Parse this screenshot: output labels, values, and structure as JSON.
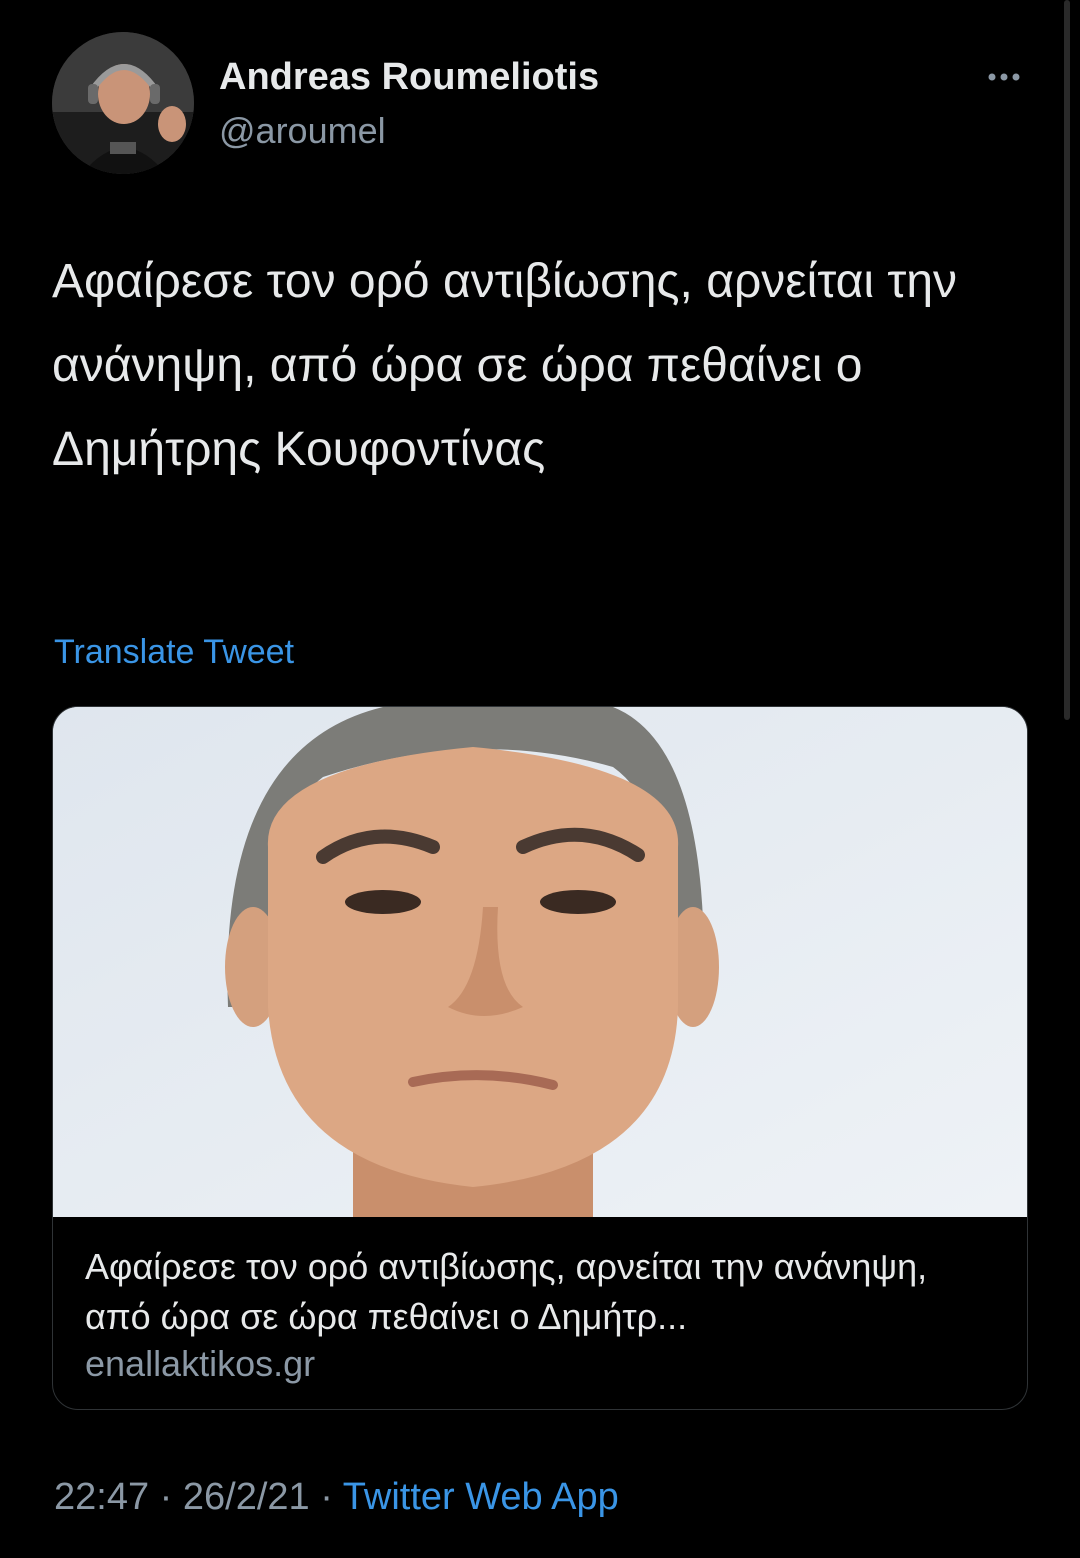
{
  "author": {
    "name": "Andreas Roumeliotis",
    "handle": "@aroumel"
  },
  "menu": {
    "more_icon": "more-horizontal-icon"
  },
  "tweet": {
    "text": "Αφαίρεσε τον ορό αντιβίωσης, αρνείται την ανάνηψη, από ώρα σε ώρα πεθαίνει ο Δημήτρης Κουφοντίνας",
    "translate_label": "Translate Tweet"
  },
  "card": {
    "title": "Αφαίρεσε τον ορό αντιβίωσης, αρνείται την ανάνηψη, από ώρα σε ώρα πεθαίνει ο Δημήτρ...",
    "domain": "enallaktikos.gr"
  },
  "meta": {
    "time": "22:47",
    "separator": "·",
    "date": "26/2/21",
    "source": "Twitter Web App"
  },
  "colors": {
    "background": "#000000",
    "text_primary": "#e7e9ea",
    "text_secondary": "#8b98a5",
    "link": "#3a95e6",
    "card_border": "#2f3336"
  }
}
